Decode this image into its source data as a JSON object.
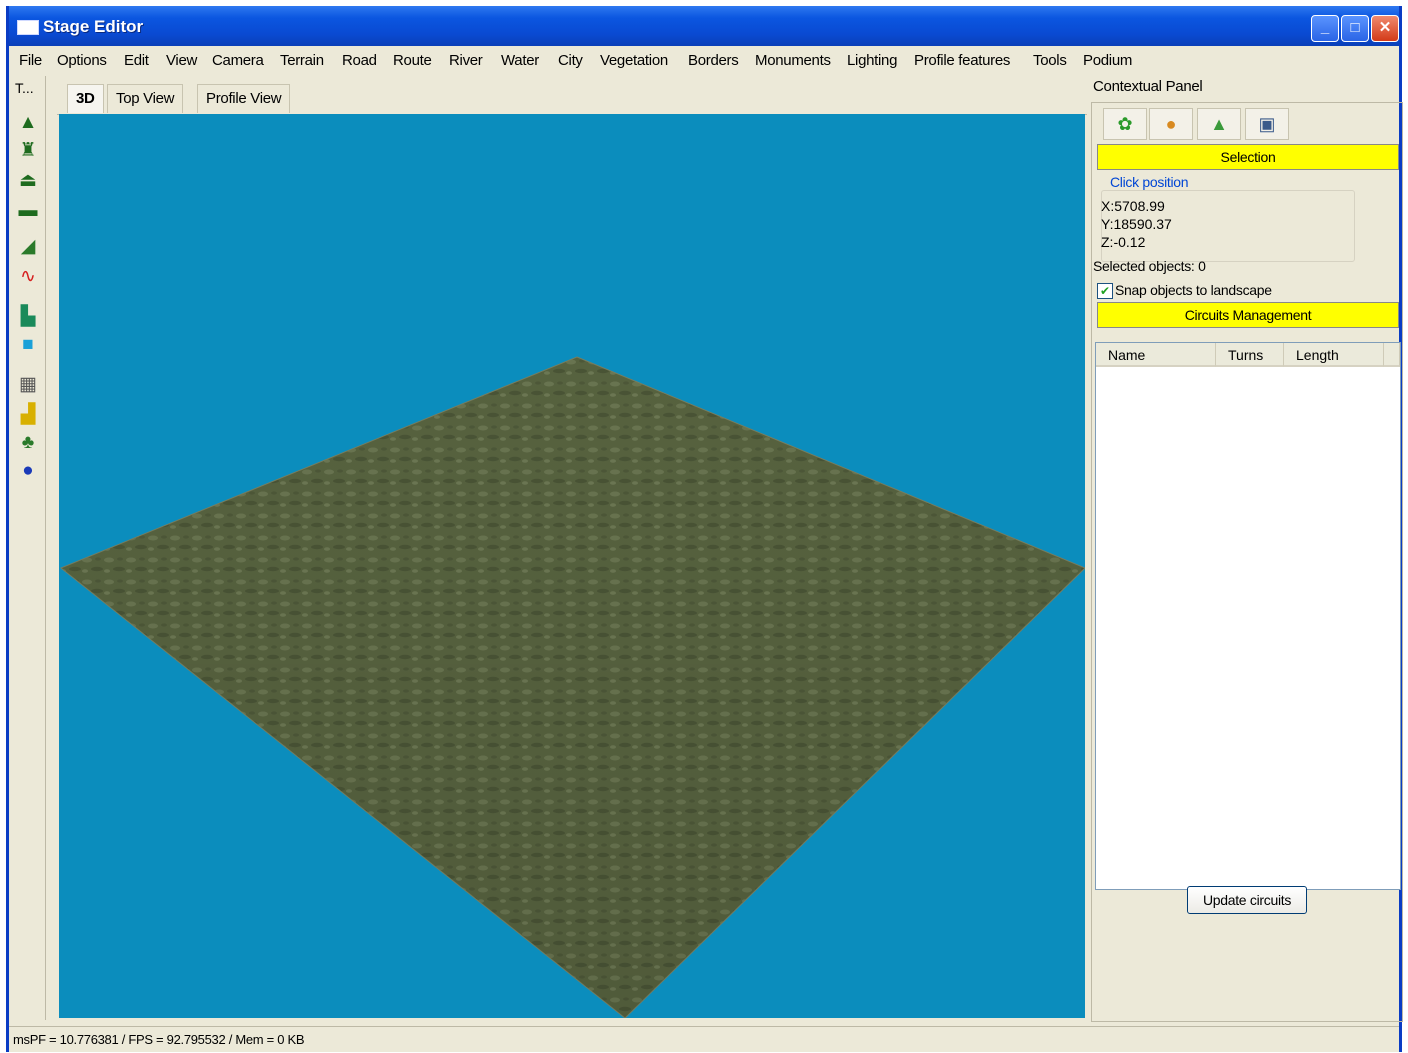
{
  "window": {
    "title": "Stage Editor"
  },
  "menu": [
    "File",
    "Options",
    "Edit",
    "View",
    "Camera",
    "Terrain",
    "Road",
    "Route",
    "River",
    "Water",
    "City",
    "Vegetation",
    "Borders",
    "Monuments",
    "Lighting",
    "Profile features",
    "Tools",
    "Podium"
  ],
  "toolbox": {
    "title": "T..."
  },
  "view_tabs": [
    "3D",
    "Top View",
    "Profile View"
  ],
  "contextual_panel": {
    "title": "Contextual Panel",
    "selection_label": "Selection",
    "click_position": {
      "legend": "Click position",
      "x": "X:5708.99",
      "y": "Y:18590.37",
      "z": "Z:-0.12"
    },
    "selected_objects": "Selected objects: 0",
    "snap_label": "Snap objects to landscape",
    "snap_checked": true,
    "circuits_label": "Circuits Management",
    "table_headers": [
      "Name",
      "Turns",
      "Length"
    ],
    "update_button": "Update circuits"
  },
  "status": "msPF = 10.776381 / FPS = 92.795532 / Mem = 0 KB",
  "colors": {
    "sky": "#0b8dbd",
    "terrain": "#5b6742",
    "highlight": "#ffff00",
    "titlebar": "#0a4ad2"
  }
}
